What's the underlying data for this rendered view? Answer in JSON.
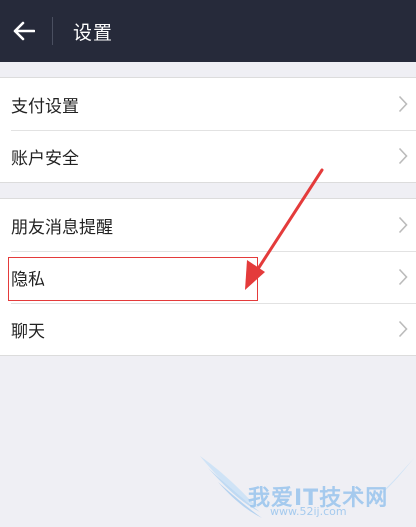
{
  "header": {
    "title": "设置",
    "back_icon": "arrow-left-icon"
  },
  "groups": [
    {
      "items": [
        {
          "label": "支付设置"
        },
        {
          "label": "账户安全"
        }
      ]
    },
    {
      "items": [
        {
          "label": "朋友消息提醒"
        },
        {
          "label": "隐私"
        },
        {
          "label": "聊天"
        }
      ]
    }
  ],
  "annotation": {
    "highlight_color": "#e43b3b"
  },
  "watermark": {
    "text": "我爱IT技术网",
    "url": "www.52ij.com"
  },
  "colors": {
    "header_bg": "#262a3a",
    "page_bg": "#efeff4",
    "row_bg": "#ffffff"
  }
}
